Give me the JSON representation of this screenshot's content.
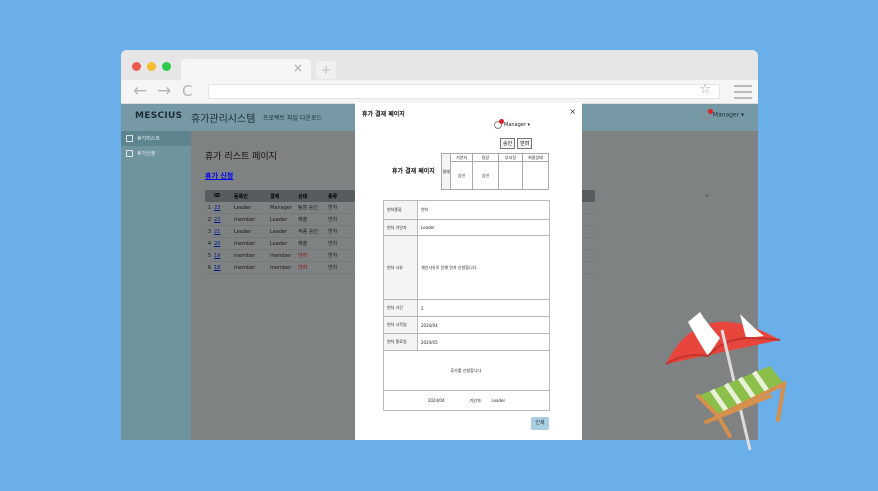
{
  "browser": {
    "newtab": "+",
    "tab_close": "×",
    "back": "←",
    "forward": "→",
    "reload": "C",
    "star": "☆"
  },
  "app": {
    "brand": "MESCIUS",
    "title": "휴가관리시스템",
    "subtitle": "프로젝트 파일 다운로드",
    "user": "Manager ▾"
  },
  "sidebar": {
    "items": [
      {
        "label": "휴가리스트"
      },
      {
        "label": "휴가신청"
      }
    ]
  },
  "main": {
    "title": "휴가 리스트 페이지",
    "apply_link": "휴가 신청",
    "right_marker": "⊣",
    "grid": {
      "headers": [
        "",
        "ID",
        "등록인",
        "결재",
        "상태",
        "종류"
      ],
      "rows": [
        {
          "n": "1",
          "id": "23",
          "user": "Leader",
          "approver": "Manager",
          "state": "팀장 승인",
          "type": "연차",
          "state_red": false
        },
        {
          "n": "2",
          "id": "22",
          "user": "member",
          "approver": "Leader",
          "state": "제출",
          "type": "연차",
          "state_red": false
        },
        {
          "n": "3",
          "id": "21",
          "user": "Leader",
          "approver": "Leader",
          "state": "작종 승인",
          "type": "연차",
          "state_red": false
        },
        {
          "n": "4",
          "id": "20",
          "user": "member",
          "approver": "Leader",
          "state": "제출",
          "type": "연차",
          "state_red": false
        },
        {
          "n": "5",
          "id": "19",
          "user": "member",
          "approver": "member",
          "state": "반려",
          "type": "연차",
          "state_red": true
        },
        {
          "n": "6",
          "id": "18",
          "user": "member",
          "approver": "member",
          "state": "반려",
          "type": "연차",
          "state_red": true
        }
      ]
    }
  },
  "modal": {
    "title": "휴가 결재 페이지",
    "close": "×",
    "user": "Manager ▾",
    "approve_btn": "승인",
    "reject_btn": "반려",
    "heading": "휴가 결재 페이지",
    "approval": {
      "side": "결재",
      "cols": [
        "기안자",
        "팀장",
        "부서장",
        "최종상태"
      ],
      "vals": [
        "승인",
        "승인",
        "",
        ""
      ]
    },
    "rows": [
      {
        "label": "연차종류",
        "value": "연차"
      },
      {
        "label": "연차 기안자",
        "value": "Leader"
      },
      {
        "label": "연차 사유",
        "value": "개인사유로 인해 연차 신청합니다."
      },
      {
        "label": "연차 기간",
        "value": "2"
      },
      {
        "label": "연차 시작일",
        "value": "2024/04"
      },
      {
        "label": "연차 종료일",
        "value": "2024/05"
      }
    ],
    "footer_msg": "휴가를 신청합니다.",
    "footer_date": "2024/04",
    "footer_label": "기안자:",
    "footer_name": "Leader",
    "print_btn": "인쇄"
  }
}
